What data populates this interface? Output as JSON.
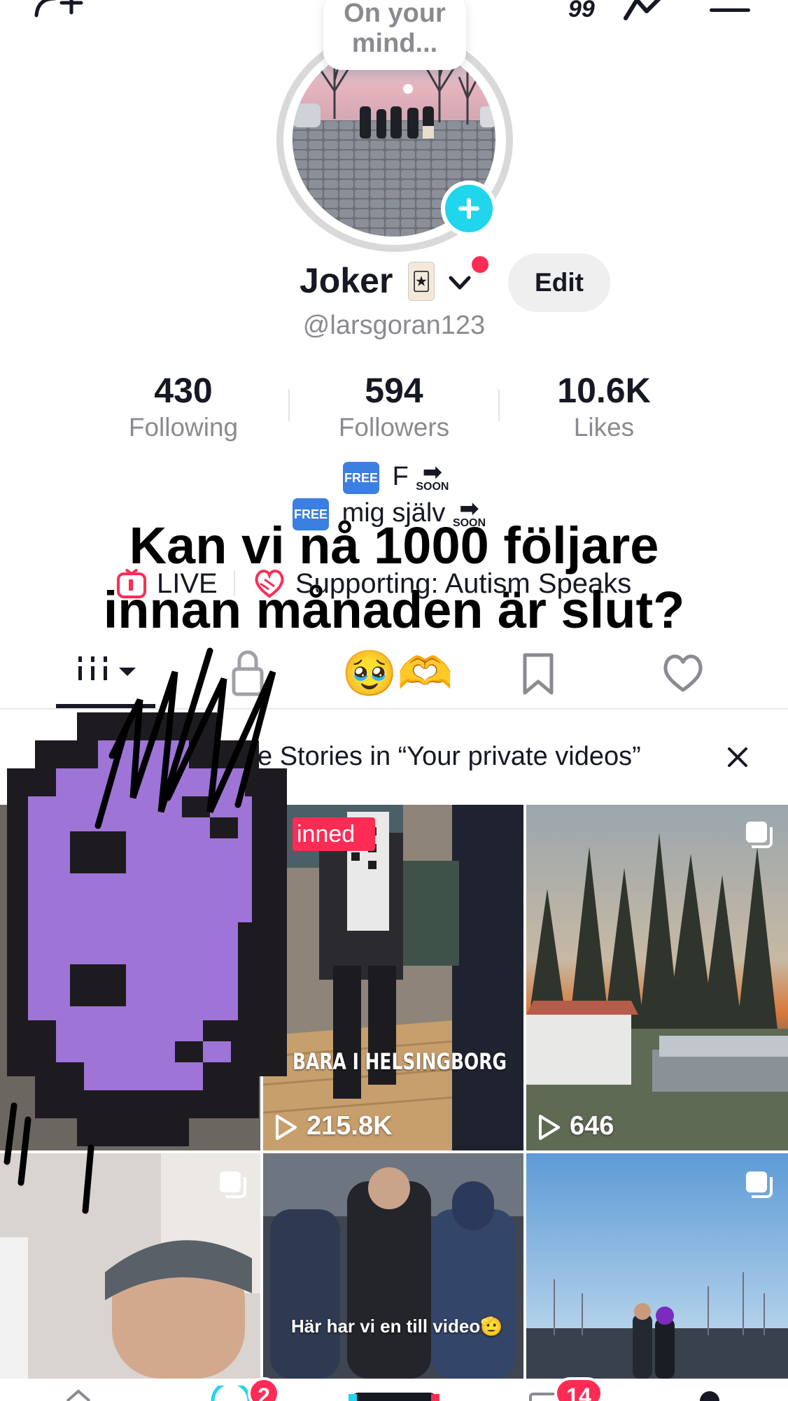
{
  "header": {
    "notification_count": "99"
  },
  "profile": {
    "note_bubble": "On your mind...",
    "name": "Joker",
    "name_emoji": "🃏",
    "edit_label": "Edit",
    "handle": "@larsgoran123"
  },
  "stats": [
    {
      "value": "430",
      "label": "Following"
    },
    {
      "value": "594",
      "label": "Followers"
    },
    {
      "value": "10.6K",
      "label": "Likes"
    }
  ],
  "bio": {
    "line1_text": "F",
    "line2_text": "mig själv",
    "free_label": "FREE",
    "soon_label": "SOON",
    "overlay_line1": "Kan vi nå 1000 följare",
    "overlay_line2": "innan månaden är slut?",
    "live_label": "LIVE",
    "supporting_label": "Supporting: Autism Speaks"
  },
  "tabs": {
    "favorites_emoji": "🥹🫶"
  },
  "banner": {
    "text": "e Stories in “Your private videos”"
  },
  "videos": [
    {
      "pinned_label": "inned",
      "caption": "BARA I HELSINGBORG",
      "views": "215.8K"
    },
    {
      "views": "646"
    },
    {
      "caption": "Här har vi en till video🫡"
    }
  ],
  "bottom_nav": {
    "inbox_badge": "14",
    "friends_badge": "2"
  }
}
